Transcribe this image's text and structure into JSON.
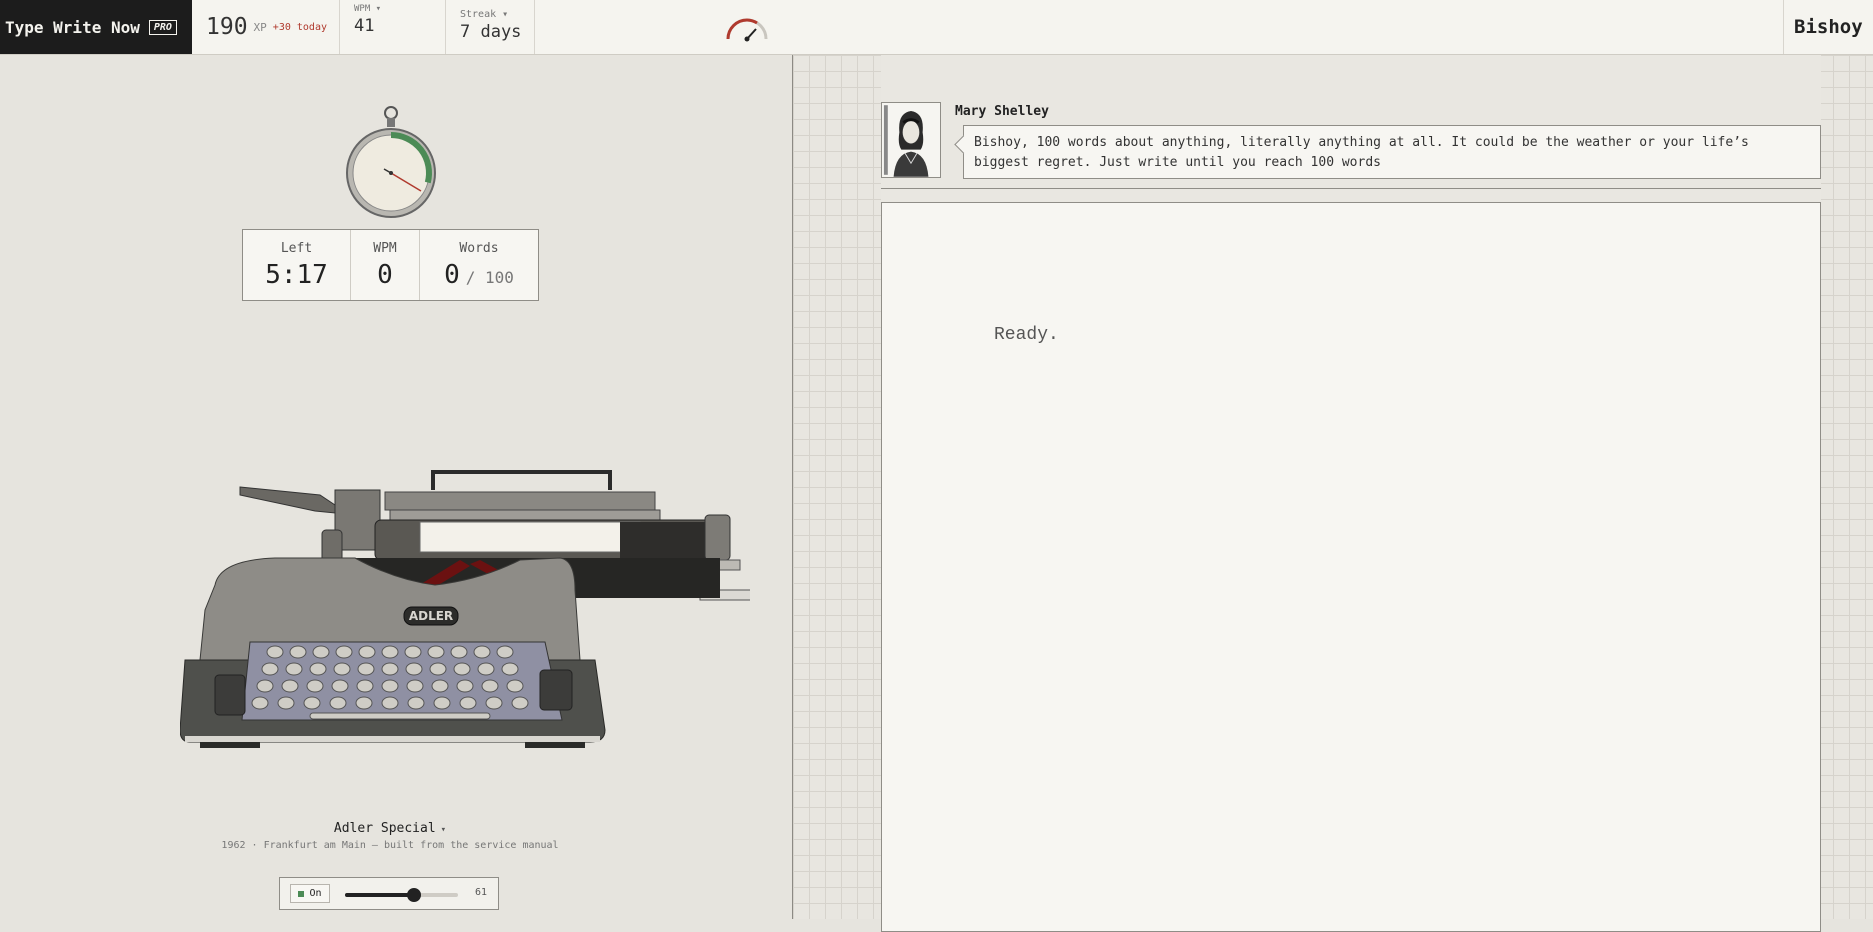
{
  "header": {
    "brand": "Type Write Now",
    "pro_badge": "PRO",
    "xp_value": "190",
    "xp_unit": "XP",
    "xp_today": "+30 today",
    "wpm_label": "WPM ▾",
    "wpm_value": "41",
    "streak_label": "Streak ▾",
    "streak_value": "7 days",
    "user_name": "Bishoy"
  },
  "timer": {
    "left_label": "Left",
    "left_value": "5:17",
    "wpm_label": "WPM",
    "wpm_value": "0",
    "words_label": "Words",
    "words_value": "0",
    "words_goal": "/ 100",
    "elapsed_fraction": 0.29
  },
  "machine": {
    "name": "Adler Special",
    "caret": "▾",
    "subtitle": "1962 · Frankfurt am Main — built from the service manual",
    "brand_plate": "ADLER"
  },
  "sound": {
    "toggle_label": "On",
    "volume": 61,
    "volume_label": "61"
  },
  "prompt": {
    "author": "Mary Shelley",
    "message": "Bishoy, 100 words about anything, literally anything at all. It could be the weather or your life’s biggest regret. Just write until you reach 100 words"
  },
  "editor": {
    "status": "Ready."
  },
  "colors": {
    "brand_bg": "#1c1c1c",
    "accent_red": "#b03a2e",
    "progress_green": "#4c8b56"
  }
}
